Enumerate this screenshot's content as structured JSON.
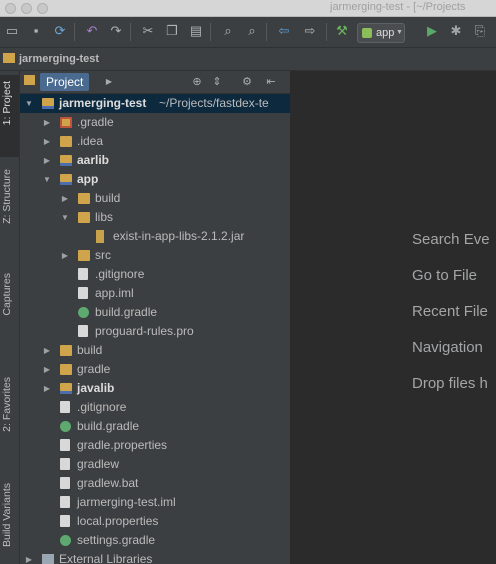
{
  "window": {
    "title": "jarmerging-test - [~/Projects"
  },
  "toolbar": {
    "run_config": "app",
    "icons": [
      "folder-open-icon",
      "save-icon",
      "sync-icon",
      "undo-icon",
      "redo-icon",
      "cut-icon",
      "copy-icon",
      "paste-icon",
      "find-icon",
      "replace-icon",
      "back-icon",
      "forward-icon",
      "build-icon",
      "run-icon",
      "debug-icon",
      "attach-debugger-icon"
    ]
  },
  "navbar": {
    "breadcrumb": "jarmerging-test"
  },
  "left_tabs": {
    "project": "1: Project",
    "structure": "Z: Structure",
    "captures": "Captures",
    "favorites": "2: Favorites",
    "build_variants": "Build Variants"
  },
  "panel": {
    "title": "Project"
  },
  "tree": [
    {
      "label": "jarmerging-test",
      "suffix": " ~/Projects/fastdex-te",
      "icon": "module",
      "arrow": "open",
      "selected": true,
      "bold": true
    },
    {
      "label": ".gradle",
      "icon": "folder-excluded",
      "arrow": "closed"
    },
    {
      "label": ".idea",
      "icon": "folder",
      "arrow": "closed"
    },
    {
      "label": "aarlib",
      "icon": "module",
      "arrow": "closed",
      "bold": true
    },
    {
      "label": "app",
      "icon": "module",
      "arrow": "open",
      "bold": true
    },
    {
      "label": "build",
      "icon": "folder",
      "arrow": "closed"
    },
    {
      "label": "libs",
      "icon": "folder",
      "arrow": "open"
    },
    {
      "label": "exist-in-app-libs-2.1.2.jar",
      "icon": "jar",
      "arrow": "none"
    },
    {
      "label": "src",
      "icon": "folder",
      "arrow": "closed"
    },
    {
      "label": ".gitignore",
      "icon": "gitignore",
      "arrow": "none"
    },
    {
      "label": "app.iml",
      "icon": "iml",
      "arrow": "none"
    },
    {
      "label": "build.gradle",
      "icon": "gradle",
      "arrow": "none"
    },
    {
      "label": "proguard-rules.pro",
      "icon": "text",
      "arrow": "none"
    },
    {
      "label": "build",
      "icon": "folder",
      "arrow": "closed"
    },
    {
      "label": "gradle",
      "icon": "folder",
      "arrow": "closed"
    },
    {
      "label": "javalib",
      "icon": "module",
      "arrow": "closed",
      "bold": true
    },
    {
      "label": ".gitignore",
      "icon": "gitignore",
      "arrow": "none"
    },
    {
      "label": "build.gradle",
      "icon": "gradle",
      "arrow": "none"
    },
    {
      "label": "gradle.properties",
      "icon": "properties",
      "arrow": "none"
    },
    {
      "label": "gradlew",
      "icon": "text",
      "arrow": "none"
    },
    {
      "label": "gradlew.bat",
      "icon": "text",
      "arrow": "none"
    },
    {
      "label": "jarmerging-test.iml",
      "icon": "iml",
      "arrow": "none"
    },
    {
      "label": "local.properties",
      "icon": "properties",
      "arrow": "none"
    },
    {
      "label": "settings.gradle",
      "icon": "gradle",
      "arrow": "none"
    },
    {
      "label": "External Libraries",
      "icon": "library",
      "arrow": "closed"
    }
  ],
  "editor_hints": [
    "Search Eve",
    "Go to File",
    "Recent File",
    "Navigation",
    "Drop files h"
  ],
  "colors": {
    "selection": "#0d293e",
    "panel_bg": "#3c3f41",
    "editor_bg": "#2b2b2b",
    "folder": "#cfa44a",
    "gradle": "#5ea96f",
    "run": "#59a869"
  }
}
